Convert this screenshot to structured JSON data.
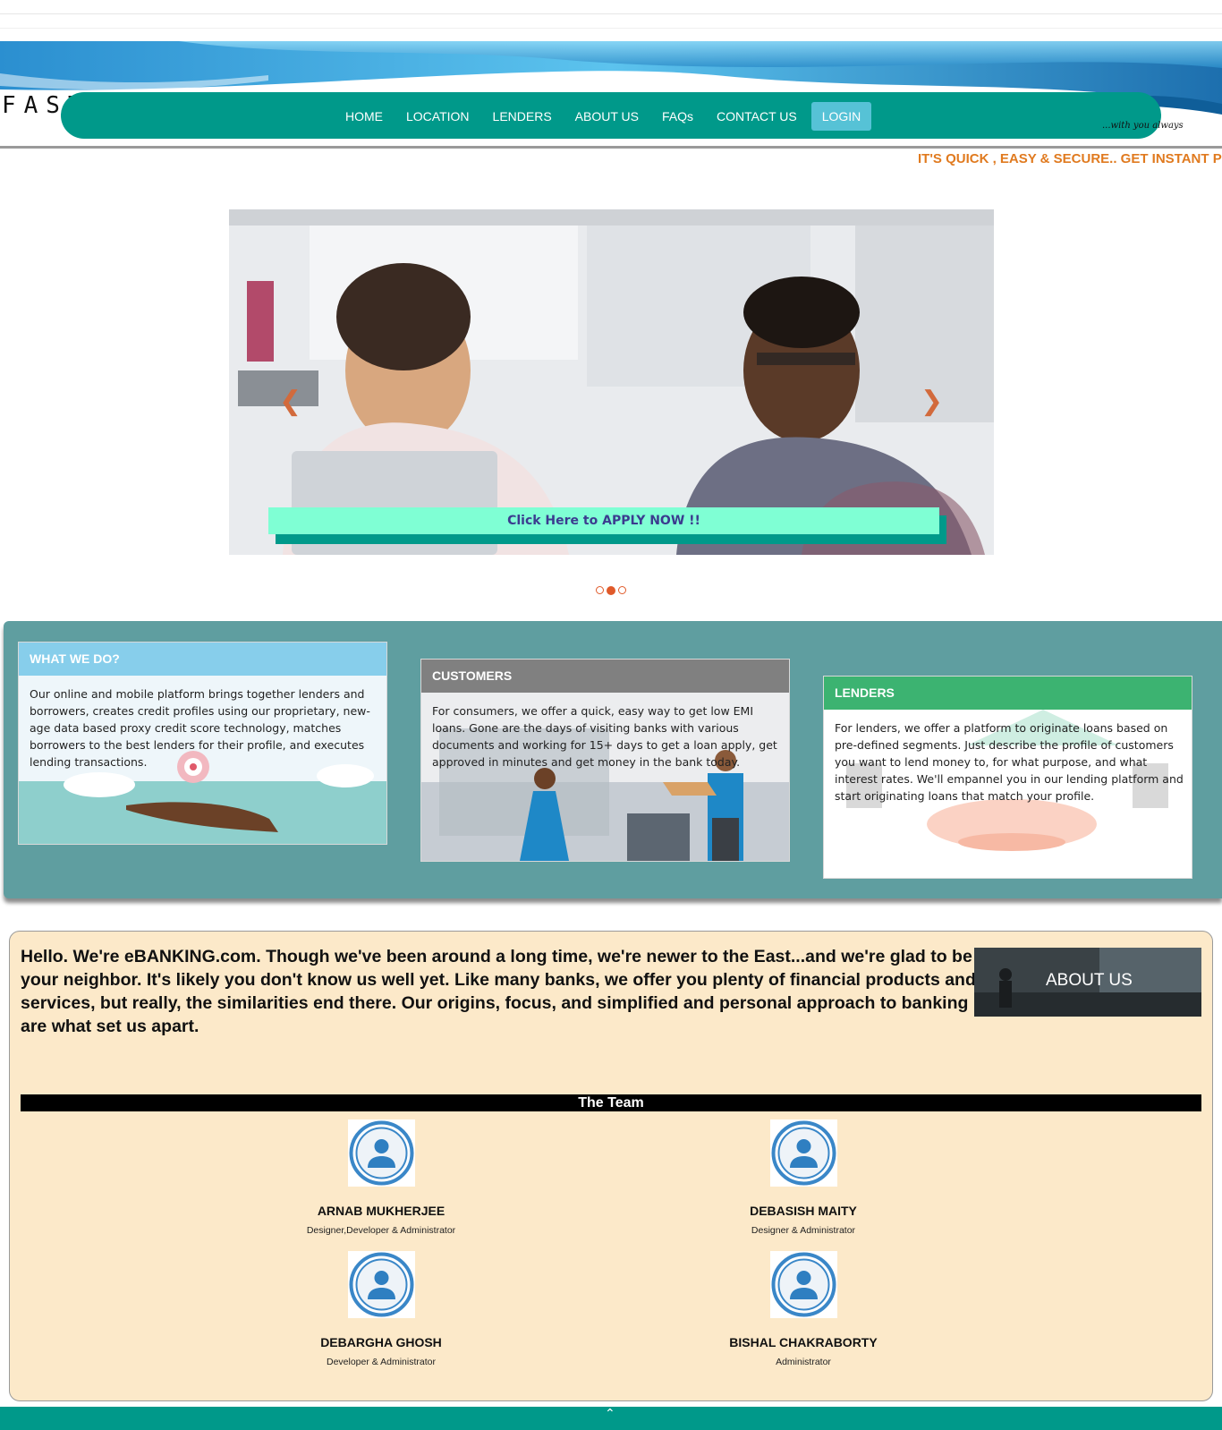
{
  "brand": {
    "name": "FASTeLoan",
    "tagline": "...with you always"
  },
  "nav": {
    "items": [
      "HOME",
      "LOCATION",
      "LENDERS",
      "ABOUT US",
      "FAQs",
      "CONTACT US"
    ],
    "login_label": "LOGIN"
  },
  "ticker": "IT'S QUICK , EASY & SECURE.. GET INSTANT PERSONAL LOANS",
  "carousel": {
    "prev_icon": "chevron-left-icon",
    "next_icon": "chevron-right-icon",
    "apply_label": "Click Here to APPLY NOW !!",
    "slide_count": 3,
    "active_slide": 2
  },
  "cards": [
    {
      "title": "WHAT WE DO?",
      "text": "Our online and mobile platform brings together lenders and borrowers, creates credit profiles using our proprietary, new-age data based proxy credit score technology, matches borrowers to the best lenders for their profile, and executes lending transactions.",
      "header_color": "#87ceeb"
    },
    {
      "title": "CUSTOMERS",
      "text": "For consumers, we offer a quick, easy way to get low EMI loans. Gone are the days of visiting banks with various documents and working for 15+ days to get a loan apply, get approved in minutes and get money in the bank today.",
      "header_color": "#808080"
    },
    {
      "title": "LENDERS",
      "text": "For lenders, we offer a platform to originate loans based on pre-defined segments. Just describe the profile of customers you want to lend money to, for what purpose, and what interest rates. We'll empannel you in our lending platform and start originating loans that match your profile.",
      "header_color": "#3cb371"
    }
  ],
  "about": {
    "text": "Hello. We're eBANKING.com. Though we've been around a long time, we're newer to the East...and we're glad to be your neighbor. It's likely you don't know us well yet. Like many banks, we offer you plenty of financial products and services, but really, the similarities end there. Our origins, focus, and simplified and personal approach to banking are what set us apart.",
    "button_label": "ABOUT US"
  },
  "team": {
    "title": "The Team",
    "members": [
      {
        "name": "ARNAB MUKHERJEE",
        "role": "Designer,Developer & Administrator"
      },
      {
        "name": "DEBASISH MAITY",
        "role": "Designer & Administrator"
      },
      {
        "name": "DEBARGHA GHOSH",
        "role": "Developer & Administrator"
      },
      {
        "name": "BISHAL CHAKRABORTY",
        "role": "Administrator"
      }
    ]
  },
  "footer": {
    "up_icon": "chevron-up-icon"
  },
  "colors": {
    "teal": "#00998a",
    "panel": "#5f9ea0",
    "ticker": "#e07a1f",
    "about_bg": "#fce9c9",
    "apply_bg": "#7fffd4"
  }
}
